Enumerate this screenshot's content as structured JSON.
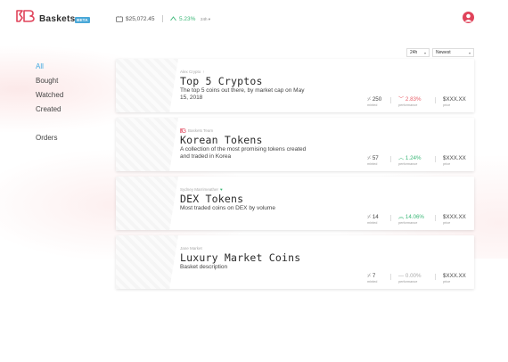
{
  "header": {
    "brand": "Baskets",
    "beta_badge": "BETA",
    "balance": "$25,072.45",
    "change": "5.23%",
    "range": "24h ▾"
  },
  "controls": {
    "period": "24h",
    "sort": "Newest"
  },
  "sidebar": {
    "items": [
      {
        "label": "All",
        "active": true
      },
      {
        "label": "Bought",
        "active": false
      },
      {
        "label": "Watched",
        "active": false
      },
      {
        "label": "Created",
        "active": false
      },
      {
        "label": "Orders",
        "active": false
      }
    ]
  },
  "baskets": [
    {
      "author": "Alex Crypto",
      "author_icon": "↑",
      "title": "Top 5 Cryptos",
      "description": "The top 5 coins out there, by market cap on May 15, 2018",
      "minted": "250",
      "minted_label": "minted",
      "performance": "2.83%",
      "performance_dir": "down",
      "performance_label": "performance",
      "price": "$XXX.XX",
      "price_label": "price"
    },
    {
      "author": "Baskets Team",
      "author_icon": "logo",
      "title": "Korean Tokens",
      "description": "A collection of the most promising tokens created and traded in Korea",
      "minted": "57",
      "minted_label": "minted",
      "performance": "1.24%",
      "performance_dir": "up",
      "performance_label": "performance",
      "price": "$XXX.XX",
      "price_label": "price"
    },
    {
      "author": "Sydney Marrimeather",
      "author_icon": "♥",
      "title": "DEX Tokens",
      "description": "Most traded coins on DEX by volume",
      "minted": "14",
      "minted_label": "minted",
      "performance": "14.06%",
      "performance_dir": "up",
      "performance_label": "performance",
      "price": "$XXX.XX",
      "price_label": "price"
    },
    {
      "author": "Jane Market",
      "author_icon": "",
      "title": "Luxury Market Coins",
      "description": "Basket description",
      "minted": "7",
      "minted_label": "minted",
      "performance": "0.00%",
      "performance_dir": "flat",
      "performance_label": "performance",
      "price": "$XXX.XX",
      "price_label": "price"
    }
  ],
  "colors": {
    "accent_red": "#e0435a",
    "accent_blue": "#3fa8e0",
    "positive": "#3cb878",
    "negative": "#e8606a"
  }
}
